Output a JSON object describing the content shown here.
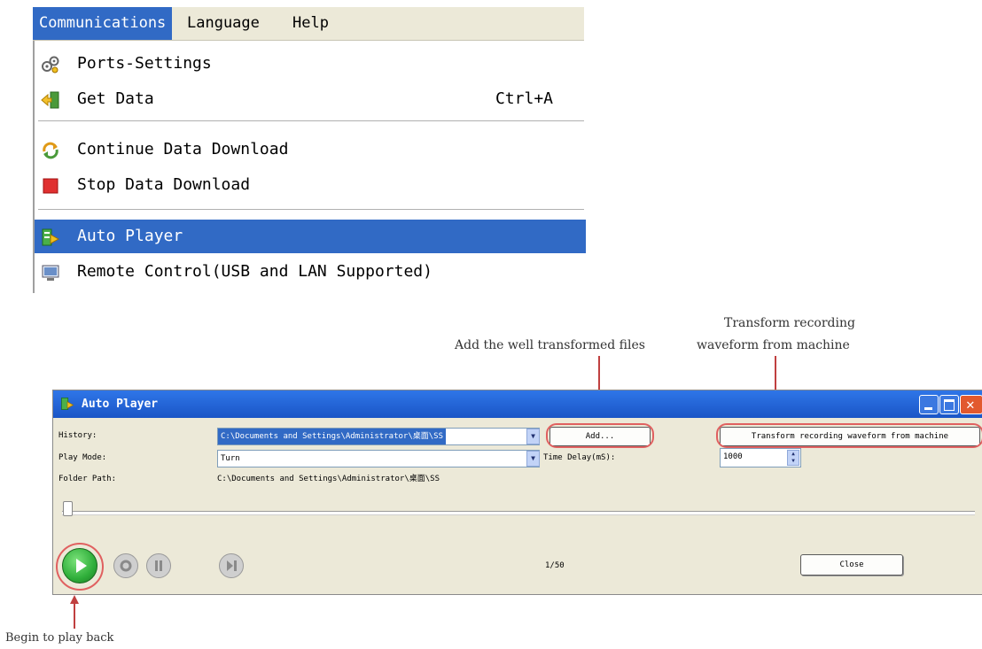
{
  "menubar": {
    "items": [
      "Communications",
      "Language",
      "Help"
    ]
  },
  "menu": {
    "ports_settings": "Ports-Settings",
    "get_data": "Get Data",
    "get_data_shortcut": "Ctrl+A",
    "continue_download": "Continue Data Download",
    "stop_download": "Stop Data Download",
    "auto_player": "Auto Player",
    "remote_control": "Remote Control(USB and LAN Supported)"
  },
  "annotations": {
    "add_files": "Add the well transformed files",
    "transform_line1": "Transform recording",
    "transform_line2": "waveform from machine",
    "begin_play": "Begin to play back"
  },
  "dialog": {
    "title": "Auto Player",
    "history_label": "History:",
    "history_value": "C:\\Documents and Settings\\Administrator\\桌面\\SS",
    "play_mode_label": "Play Mode:",
    "play_mode_value": "Turn",
    "time_delay_label": "Time Delay(mS):",
    "time_delay_value": "1000",
    "folder_path_label": "Folder Path:",
    "folder_path_value": "C:\\Documents and Settings\\Administrator\\桌面\\SS",
    "add_button": "Add...",
    "transform_button": "Transform recording waveform from machine",
    "counter": "1/50",
    "close_button": "Close"
  },
  "colors": {
    "highlight": "#316ac5",
    "annotation": "#e06060",
    "titlebar": "#1a55c6",
    "play_green": "#2fae3a"
  }
}
